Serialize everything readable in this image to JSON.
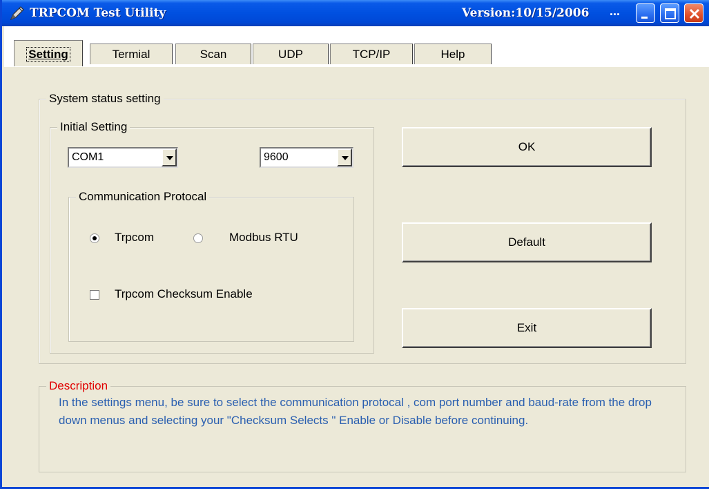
{
  "window": {
    "title": "TRPCOM Test Utility",
    "version": "Version:10/15/2006",
    "ellipsis": "...",
    "accent_color": "#0a46d6"
  },
  "tabs": [
    {
      "label": "Setting",
      "active": true
    },
    {
      "label": "Termial"
    },
    {
      "label": "Scan"
    },
    {
      "label": "UDP"
    },
    {
      "label": "TCP/IP"
    },
    {
      "label": "Help"
    }
  ],
  "system_status": {
    "label": "System status setting",
    "initial_setting": {
      "label": "Initial Setting",
      "com_port": "COM1",
      "baud_rate": "9600"
    },
    "protocol": {
      "label": "Communication Protocal",
      "option_trpcom": "Trpcom",
      "option_modbus": "Modbus RTU",
      "selected": "Trpcom",
      "checksum_label": "Trpcom Checksum Enable",
      "checksum_checked": false
    }
  },
  "buttons": {
    "ok": "OK",
    "default": "Default",
    "exit": "Exit"
  },
  "description": {
    "label": "Description",
    "text": "In the settings menu, be sure to select the communication protocal , com port number and baud-rate from the drop down menus and selecting your \"Checksum Selects \" Enable or Disable before continuing."
  }
}
